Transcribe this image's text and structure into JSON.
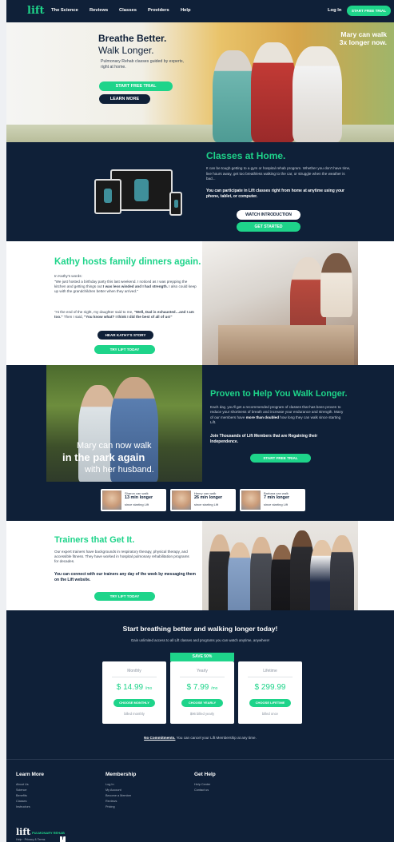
{
  "nav": {
    "logo": "lift",
    "items": [
      "The Science",
      "Reviews",
      "Classes",
      "Providers",
      "Help"
    ],
    "login": "Log In",
    "cta": "START FREE TRIAL"
  },
  "hero": {
    "title_line1": "Breathe Better.",
    "title_line2": "Walk Longer.",
    "subtitle": "Pulmonary Rehab classes guided by experts, right at home.",
    "primary_btn": "START FREE TRIAL",
    "secondary_btn": "LEARN MORE",
    "quote_line1": "Mary can walk",
    "quote_line2": "3x longer now."
  },
  "classes_home": {
    "title": "Classes at Home.",
    "paragraph": "It can be tough getting to a gym or hospital rehab program. Whether you don't have time, live hours away, get too breathless walking to the car, or struggle when the weather is bad...",
    "emphasis": "You can participate in Lift classes right from home at anytime using your phone, tablet, or computer.",
    "watch_btn": "WATCH INTRODUCTION",
    "start_btn": "GET STARTED"
  },
  "kathy": {
    "title": "Kathy hosts family dinners again.",
    "intro": "In Kathy's words:",
    "p1_a": "\"We just hosted a birthday party this last weekend. I noticed as I was prepping the kitchen and getting things out ",
    "p1_b": "I was less winded and I had strength.",
    "p1_c": " I also could keep up with the grandchildren better when they arrived.\"",
    "p2_a": "\"At the end of the night, my daughter said to me, ",
    "p2_b": "\"Well, Dad is exhausted…and I am too.\"",
    "p2_c": " Then I said, ",
    "p2_d": "\"You know what? I think I did the best of all of us!\"",
    "story_btn": "HEAR KATHY'S STORY",
    "try_btn": "TRY LIFT TODAY"
  },
  "proven": {
    "caption_line1": "Mary can now walk",
    "caption_line2": "in the park again",
    "caption_line3": "with her husband.",
    "title": "Proven to Help You Walk Longer.",
    "p_a": "Each day, you'll get a recommended program of classes that has been proven to reduce your shortness of breath and increase your endurance and strength. Many of our members have ",
    "p_b": "more than doubled",
    "p_c": " how long they can walk since starting Lift.",
    "emphasis": "Join Thousands of Lift Members that are Regaining their Independence.",
    "btn": "START FREE TRIAL",
    "stats": [
      {
        "name": "Sharon can walk",
        "value": "13 min longer",
        "note": "since starting Lift"
      },
      {
        "name": "Henry can walk",
        "value": "26 min longer",
        "note": "since starting Lift"
      },
      {
        "name": "Barbara can walk",
        "value": "7 min longer",
        "note": "since starting Lift"
      }
    ]
  },
  "trainers": {
    "title": "Trainers that Get It.",
    "paragraph": "Our expert trainers have backgrounds in respiratory therapy, physical therapy, and accessible fitness. They have worked in hospital pulmonary rehabilitation programs for decades.",
    "emphasis": "You can connect with our trainers any day of the week by messaging them on the Lift website.",
    "btn": "TRY LIFT TODAY"
  },
  "pricing": {
    "title": "Start breathing better and walking longer today!",
    "subtitle": "Gain unlimited access to all Lift classes and programs you can watch anytime, anywhere!",
    "save_badge": "SAVE 50%",
    "plans": [
      {
        "name": "Monthly",
        "price": "$ 14.99",
        "unit": "/mo",
        "btn": "CHOOSE MONTHLY",
        "note": "billed monthly"
      },
      {
        "name": "Yearly",
        "price": "$ 7.99",
        "unit": "/mo",
        "btn": "CHOOSE YEARLY",
        "note": "$96 billed yearly"
      },
      {
        "name": "Lifetime",
        "price": "$ 299.99",
        "unit": "",
        "btn": "CHOOSE LIFETIME",
        "note": "billed once"
      }
    ],
    "footnote_bold": "No Commitments.",
    "footnote_rest": " You can cancel your Lift Membership at any time."
  },
  "footer": {
    "learn_more": {
      "heading": "Learn More",
      "links": [
        "About Us",
        "Science",
        "Benefits",
        "Classes",
        "Instructors"
      ]
    },
    "membership": {
      "heading": "Membership",
      "links": [
        "Log In",
        "My Account",
        "Become a Member",
        "Reviews",
        "Pricing"
      ]
    },
    "get_help": {
      "heading": "Get Help",
      "links": [
        "Help Center",
        "Contact us"
      ]
    },
    "logo": "lift",
    "logo_sub": "PULMONARY REHAB",
    "bottom": "Help  ·  Privacy & Terms",
    "facebook": "f"
  },
  "colors": {
    "navy": "#0f2038",
    "accent": "#1ed48a",
    "white": "#ffffff"
  }
}
